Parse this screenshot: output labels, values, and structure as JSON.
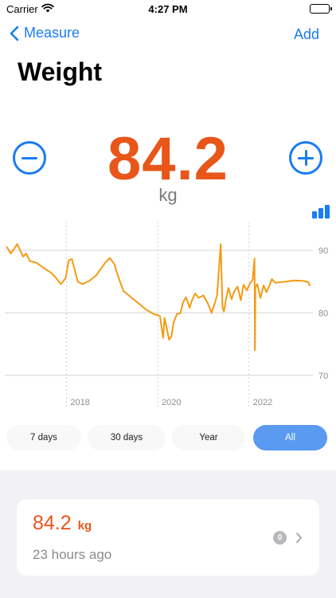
{
  "status_bar": {
    "carrier": "Carrier",
    "time": "4:27 PM"
  },
  "nav": {
    "back_label": "Measure",
    "add_label": "Add"
  },
  "title": "Weight",
  "current": {
    "value": "84.2",
    "unit": "kg"
  },
  "colors": {
    "accent": "#1a7cf0",
    "value": "#e8561a",
    "line": "#f59a14",
    "panel": "#f1f1f6"
  },
  "icons": {
    "back": "chevron-left-icon",
    "minus": "minus-circle-icon",
    "plus": "plus-circle-icon",
    "chart_type": "bar-chart-icon",
    "disclosure": "chevron-right-icon"
  },
  "chart_data": {
    "type": "line",
    "title": "",
    "xlabel": "",
    "ylabel": "",
    "x_ticks": [
      "2018",
      "2020",
      "2022"
    ],
    "x_tick_values": [
      2018,
      2020,
      2022
    ],
    "y_ticks": [
      "70",
      "80",
      "90"
    ],
    "y_tick_values": [
      70,
      80,
      90
    ],
    "xlim": [
      2016.65,
      2023.4
    ],
    "ylim": [
      67.8,
      94.6
    ],
    "grid": true,
    "series": [
      {
        "x": [
          2016.7,
          2016.78,
          2016.85,
          2016.92,
          2017.0,
          2017.05,
          2017.12,
          2017.2,
          2017.35,
          2017.5,
          2017.65,
          2017.75,
          2017.88,
          2017.98,
          2018.05,
          2018.12,
          2018.25,
          2018.3,
          2018.35,
          2018.5,
          2018.65,
          2018.85,
          2018.95,
          2019.05,
          2019.15,
          2019.25,
          2019.5,
          2019.75,
          2019.92,
          2020.05,
          2020.12,
          2020.15,
          2020.2,
          2020.25,
          2020.3,
          2020.35,
          2020.42,
          2020.5,
          2020.55,
          2020.62,
          2020.7,
          2020.75,
          2020.82,
          2020.9,
          2021.0,
          2021.1,
          2021.18,
          2021.25,
          2021.3,
          2021.38,
          2021.42,
          2021.45,
          2021.5,
          2021.55,
          2021.62,
          2021.68,
          2021.75,
          2021.82,
          2021.88,
          2021.95,
          2022.02,
          2022.08,
          2022.12,
          2022.13,
          2022.14,
          2022.18,
          2022.25,
          2022.32,
          2022.38,
          2022.45,
          2022.5,
          2022.58,
          2022.65,
          2022.8,
          2023.0,
          2023.2,
          2023.3,
          2023.33
        ],
        "y": [
          90.5,
          89.5,
          90.2,
          91.0,
          89.8,
          89.0,
          89.5,
          88.3,
          88.0,
          87.2,
          86.5,
          85.8,
          84.6,
          85.5,
          88.4,
          88.6,
          85.0,
          84.8,
          84.6,
          85.1,
          86.0,
          88.0,
          88.8,
          87.8,
          85.5,
          83.5,
          82.0,
          80.5,
          79.8,
          79.5,
          76.0,
          79.2,
          77.5,
          75.7,
          76.2,
          78.5,
          79.8,
          80.0,
          81.6,
          82.5,
          80.8,
          82.0,
          83.1,
          82.4,
          82.8,
          81.5,
          80.0,
          81.5,
          82.8,
          91.0,
          80.8,
          80.2,
          82.3,
          84.0,
          82.2,
          83.5,
          84.2,
          82.0,
          84.5,
          83.6,
          84.7,
          85.3,
          88.7,
          74.0,
          84.2,
          84.6,
          82.4,
          84.4,
          83.3,
          84.4,
          85.4,
          84.8,
          84.9,
          85.0,
          85.2,
          85.1,
          84.9,
          84.4
        ]
      }
    ]
  },
  "range_options": [
    {
      "label": "7 days",
      "active": false
    },
    {
      "label": "30 days",
      "active": false
    },
    {
      "label": "Year",
      "active": false
    },
    {
      "label": "All",
      "active": true
    }
  ],
  "latest_entry": {
    "value": "84.2",
    "unit": "kg",
    "time_ago": "23 hours ago",
    "badge": "0"
  }
}
